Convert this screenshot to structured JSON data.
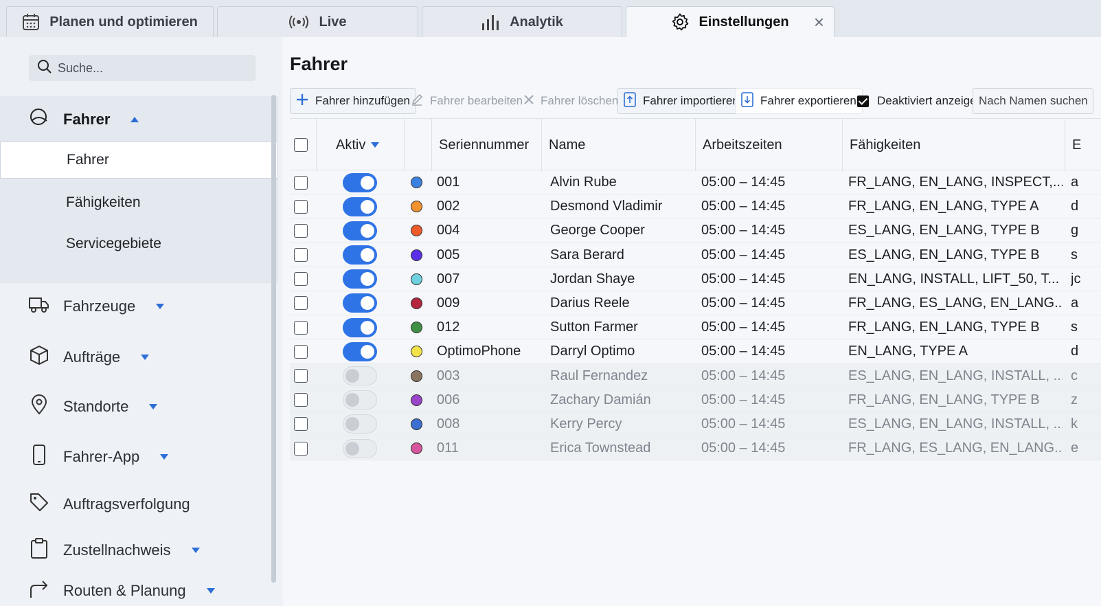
{
  "tabs": [
    {
      "label": "Planen und optimieren",
      "icon": "calendar-icon"
    },
    {
      "label": "Live",
      "icon": "broadcast-icon"
    },
    {
      "label": "Analytik",
      "icon": "bar-chart-icon"
    },
    {
      "label": "Einstellungen",
      "icon": "gear-icon",
      "close": "×"
    }
  ],
  "sidebar": {
    "search_placeholder": "Suche...",
    "sections": [
      {
        "label": "Fahrer",
        "icon": "driver-icon"
      },
      {
        "label": "Fahrzeuge",
        "icon": "truck-icon"
      },
      {
        "label": "Aufträge",
        "icon": "box-icon"
      },
      {
        "label": "Standorte",
        "icon": "location-pin-icon"
      },
      {
        "label": "Fahrer-App",
        "icon": "phone-icon"
      },
      {
        "label": "Auftragsverfolgung",
        "icon": "tag-icon"
      },
      {
        "label": "Zustellnachweis",
        "icon": "clipboard-icon"
      },
      {
        "label": "Routen & Planung",
        "icon": "route-arrow-icon"
      }
    ],
    "sub_items": [
      "Fahrer",
      "Fähigkeiten",
      "Servicegebiete"
    ]
  },
  "main": {
    "title": "Fahrer",
    "toolbar": {
      "add": "Fahrer hinzufügen",
      "edit": "Fahrer bearbeiten",
      "delete": "Fahrer löschen",
      "import": "Fahrer importieren",
      "export": "Fahrer exportieren",
      "show_disabled": "Deaktiviert anzeigen",
      "name_search_placeholder": "Nach Namen suchen"
    },
    "columns": {
      "aktiv": "Aktiv",
      "serial": "Seriennummer",
      "name": "Name",
      "hours": "Arbeitszeiten",
      "skills": "Fähigkeiten",
      "extra": "E"
    },
    "rows": [
      {
        "active": true,
        "color": "#3b82e0",
        "serial": "001",
        "name": "Alvin Rube",
        "hours": "05:00 – 14:45",
        "skills": "FR_LANG,  EN_LANG, INSPECT,...",
        "extra": "a"
      },
      {
        "active": true,
        "color": "#f0922e",
        "serial": "002",
        "name": "Desmond Vladimir",
        "hours": "05:00 – 14:45",
        "skills": "FR_LANG,  EN_LANG,  TYPE A",
        "extra": "d"
      },
      {
        "active": true,
        "color": "#ee5a2a",
        "serial": "004",
        "name": "George Cooper",
        "hours": "05:00 – 14:45",
        "skills": "ES_LANG,  EN_LANG,  TYPE B",
        "extra": "g"
      },
      {
        "active": true,
        "color": "#5b2ee8",
        "serial": "005",
        "name": "Sara Berard",
        "hours": "05:00 – 14:45",
        "skills": "ES_LANG,  EN_LANG,  TYPE B",
        "extra": "s"
      },
      {
        "active": true,
        "color": "#6fd0de",
        "serial": "007",
        "name": "Jordan Shaye",
        "hours": "05:00 – 14:45",
        "skills": "EN_LANG,  INSTALL,  LIFT_50,  T...",
        "extra": "jc"
      },
      {
        "active": true,
        "color": "#b3263e",
        "serial": "009",
        "name": "Darius Reele",
        "hours": "05:00 – 14:45",
        "skills": "FR_LANG,  ES_LANG,  EN_LANG...",
        "extra": "a"
      },
      {
        "active": true,
        "color": "#3f8f45",
        "serial": "012",
        "name": "Sutton Farmer",
        "hours": "05:00 – 14:45",
        "skills": "FR_LANG,  EN_LANG,  TYPE B",
        "extra": "s"
      },
      {
        "active": true,
        "color": "#f3e24a",
        "serial": "OptimoPhone",
        "name": "Darryl Optimo",
        "hours": "05:00 – 14:45",
        "skills": "EN_LANG,  TYPE A",
        "extra": "d"
      },
      {
        "active": false,
        "color": "#8a7560",
        "serial": "003",
        "name": "Raul Fernandez",
        "hours": "05:00 – 14:45",
        "skills": "ES_LANG,  EN_LANG,  INSTALL, ...",
        "extra": "c"
      },
      {
        "active": false,
        "color": "#9b45c9",
        "serial": "006",
        "name": "Zachary Damián",
        "hours": "05:00 – 14:45",
        "skills": "FR_LANG,  EN_LANG,  TYPE B",
        "extra": "z"
      },
      {
        "active": false,
        "color": "#3b6fd0",
        "serial": "008",
        "name": "Kerry Percy",
        "hours": "05:00 – 14:45",
        "skills": "ES_LANG,  EN_LANG,  INSTALL, ...",
        "extra": "k"
      },
      {
        "active": false,
        "color": "#d6559c",
        "serial": "011",
        "name": "Erica Townstead",
        "hours": "05:00 – 14:45",
        "skills": "FR_LANG,  ES_LANG,  EN_LANG...",
        "extra": "e"
      }
    ]
  }
}
